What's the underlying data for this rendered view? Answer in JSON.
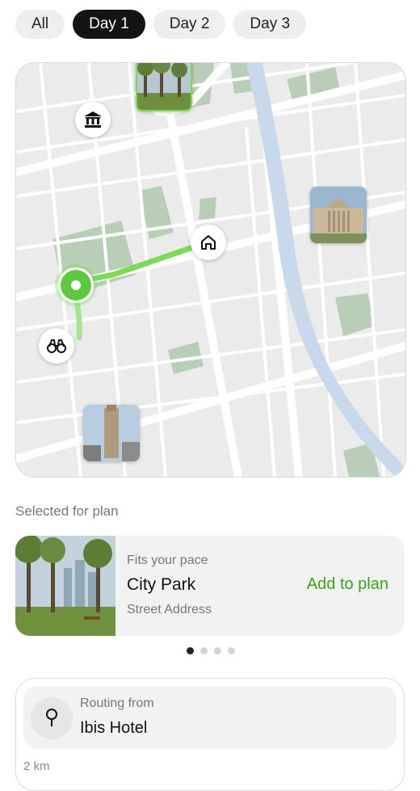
{
  "tabs": [
    {
      "label": "All",
      "active": false
    },
    {
      "label": "Day 1",
      "active": true
    },
    {
      "label": "Day 2",
      "active": false
    },
    {
      "label": "Day 3",
      "active": false
    }
  ],
  "map": {
    "pins": [
      "museum-icon",
      "home-icon",
      "binoculars-icon"
    ],
    "route_color": "#7ed957",
    "water_color": "#c7d9ea",
    "park_color": "#b5cdb3"
  },
  "selected": {
    "section_label": "Selected for plan",
    "pace": "Fits your pace",
    "name": "City Park",
    "address": "Street Address",
    "action": "Add to plan",
    "carousel_total": 4,
    "carousel_index": 1
  },
  "routing": {
    "label": "Routing from",
    "place": "Ibis Hotel",
    "distance": "2 km"
  }
}
